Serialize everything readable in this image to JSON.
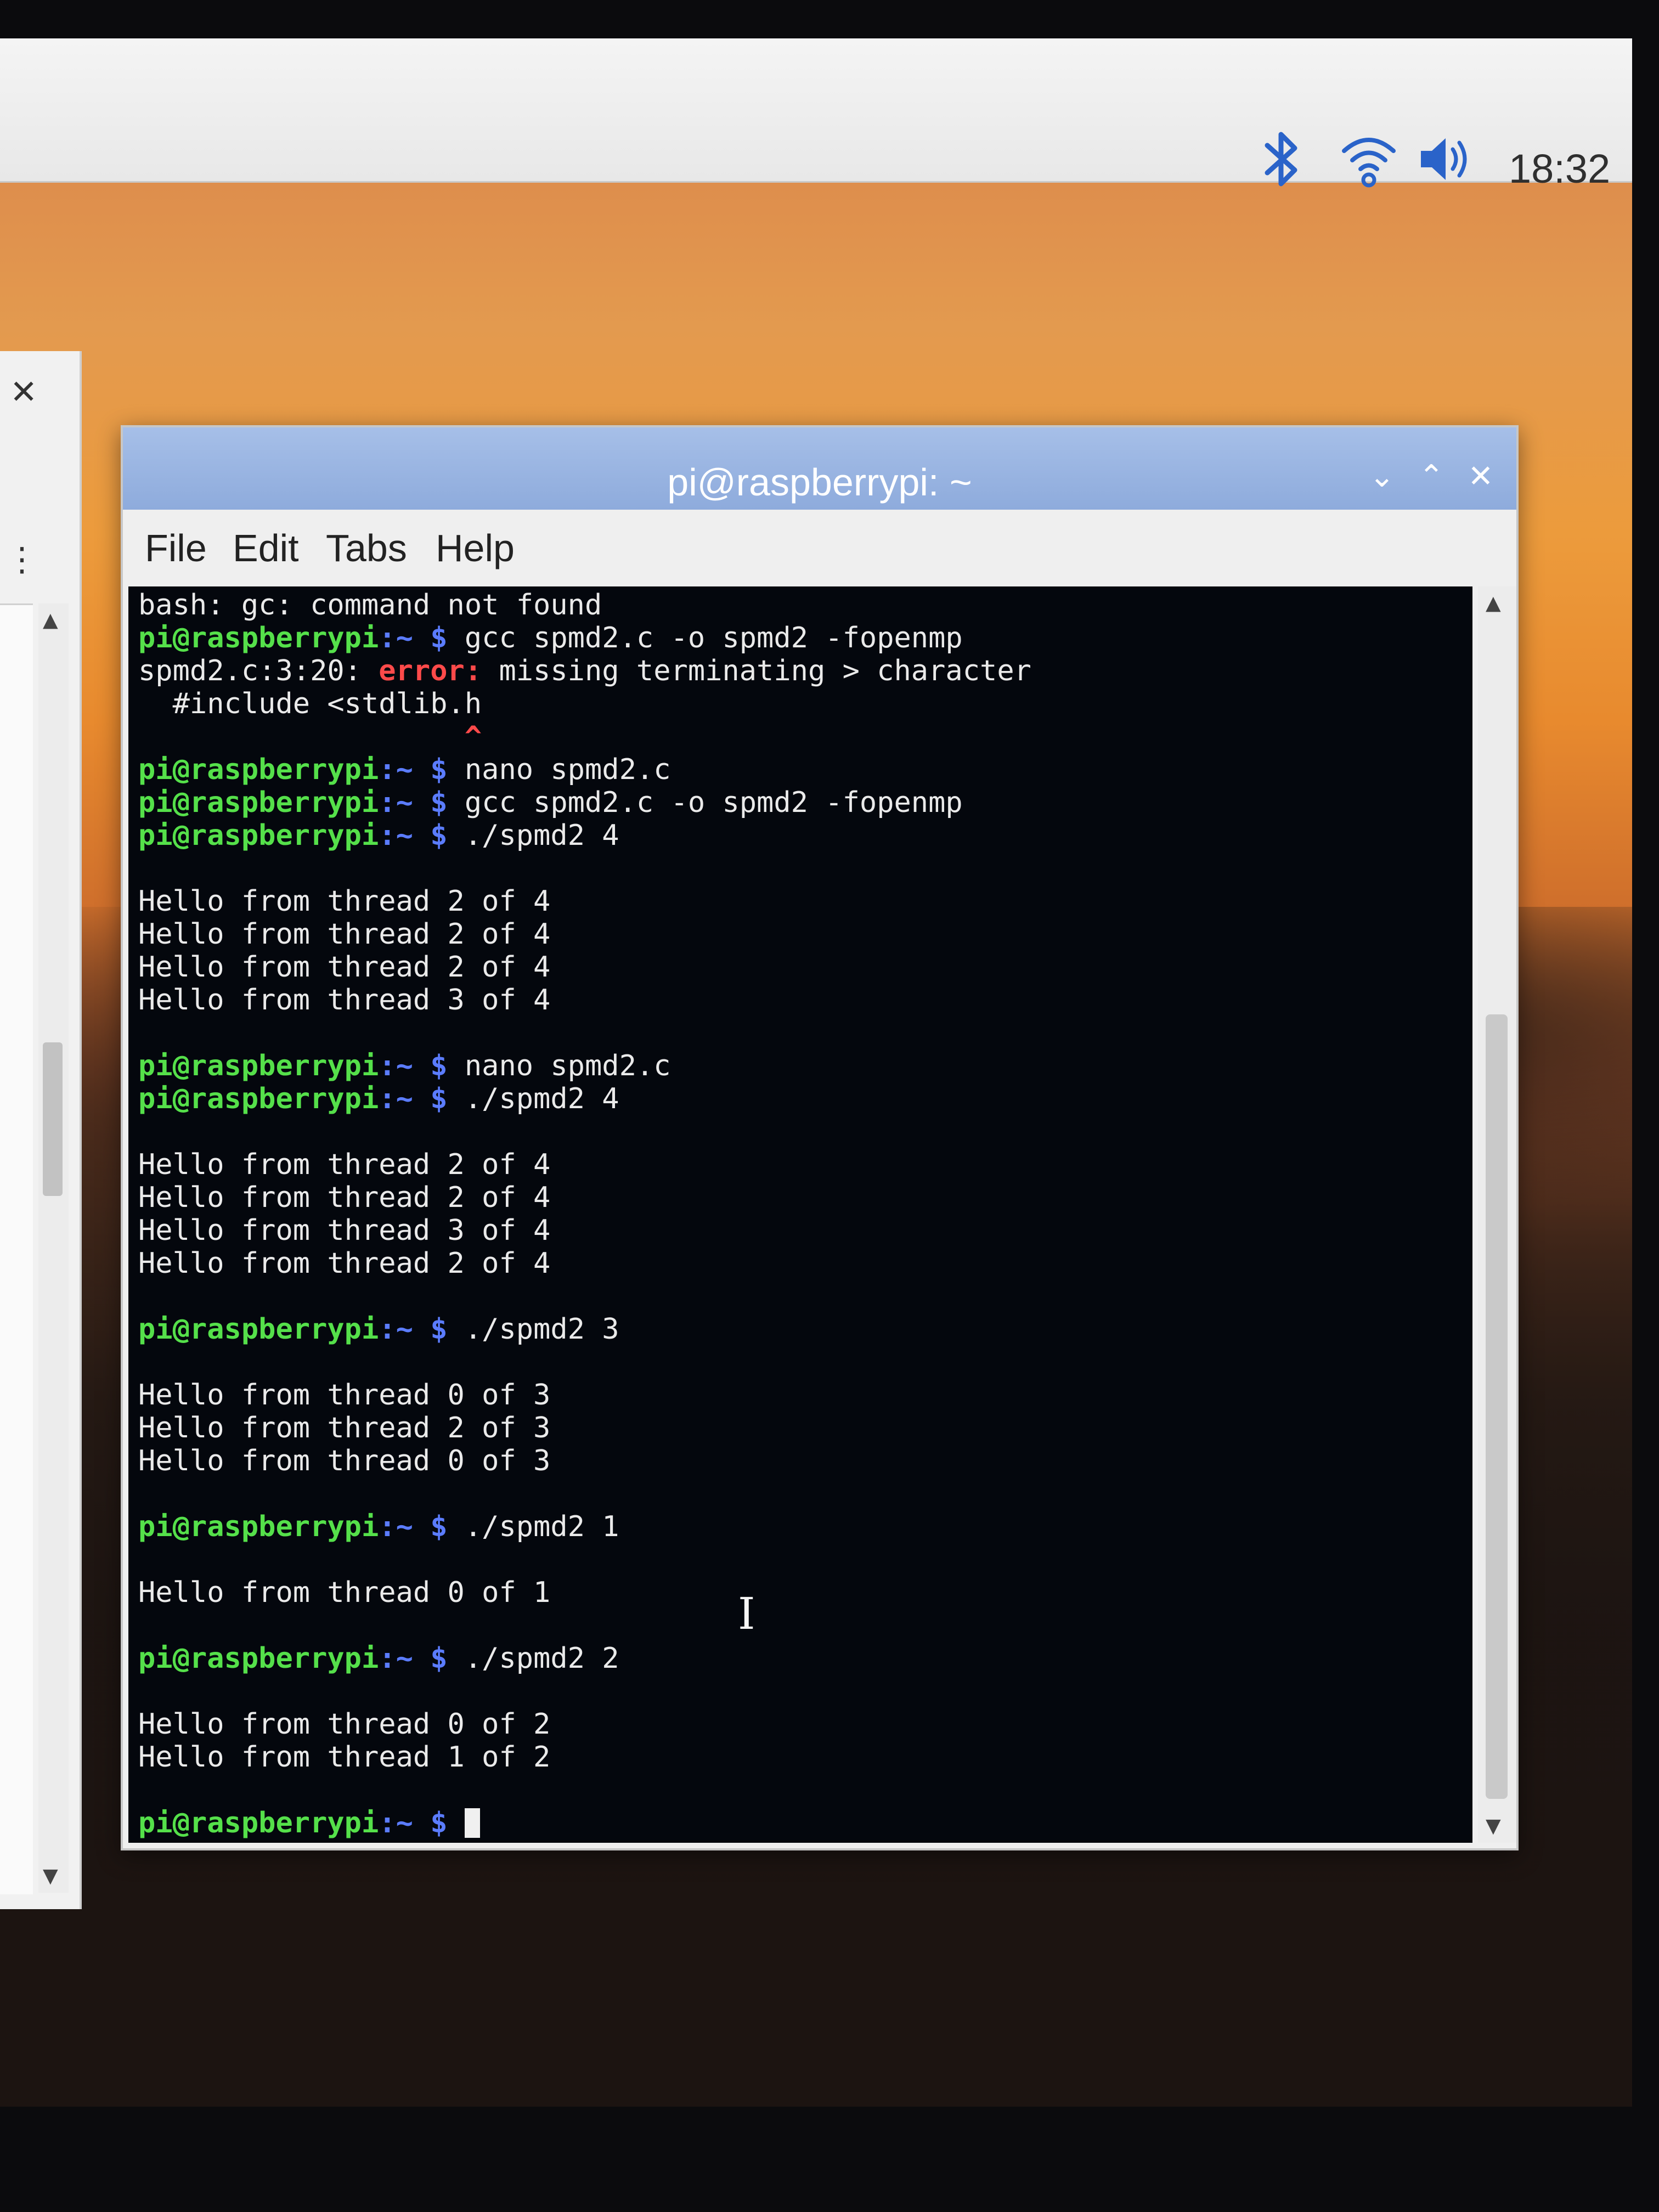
{
  "taskbar": {
    "clock": "18:32",
    "icons": [
      "bluetooth-icon",
      "wifi-icon",
      "volume-icon"
    ]
  },
  "left_window": {
    "close_symbol": "✕",
    "menu_symbol": "⋮"
  },
  "terminal_window": {
    "title": "pi@raspberrypi: ~",
    "controls": {
      "minimize": "⌄",
      "maximize": "⌃",
      "close": "✕"
    },
    "menu": [
      "File",
      "Edit",
      "Tabs",
      "Help"
    ],
    "prompt_user": "pi@raspberrypi",
    "prompt_path": ":~ $",
    "lines": [
      {
        "type": "out",
        "text": "bash: gc: command not found"
      },
      {
        "type": "cmd",
        "text": " gcc spmd2.c -o spmd2 -fopenmp"
      },
      {
        "type": "err",
        "prefix": "spmd2.c:3:20: ",
        "label": "error:",
        "text": " missing terminating > character"
      },
      {
        "type": "out",
        "text": "  #include <stdlib.h"
      },
      {
        "type": "caret",
        "text": "                   ^"
      },
      {
        "type": "cmd",
        "text": " nano spmd2.c"
      },
      {
        "type": "cmd",
        "text": " gcc spmd2.c -o spmd2 -fopenmp"
      },
      {
        "type": "cmd",
        "text": " ./spmd2 4"
      },
      {
        "type": "blank",
        "text": ""
      },
      {
        "type": "out",
        "text": "Hello from thread 2 of 4"
      },
      {
        "type": "out",
        "text": "Hello from thread 2 of 4"
      },
      {
        "type": "out",
        "text": "Hello from thread 2 of 4"
      },
      {
        "type": "out",
        "text": "Hello from thread 3 of 4"
      },
      {
        "type": "blank",
        "text": ""
      },
      {
        "type": "cmd",
        "text": " nano spmd2.c"
      },
      {
        "type": "cmd",
        "text": " ./spmd2 4"
      },
      {
        "type": "blank",
        "text": ""
      },
      {
        "type": "out",
        "text": "Hello from thread 2 of 4"
      },
      {
        "type": "out",
        "text": "Hello from thread 2 of 4"
      },
      {
        "type": "out",
        "text": "Hello from thread 3 of 4"
      },
      {
        "type": "out",
        "text": "Hello from thread 2 of 4"
      },
      {
        "type": "blank",
        "text": ""
      },
      {
        "type": "cmd",
        "text": " ./spmd2 3"
      },
      {
        "type": "blank",
        "text": ""
      },
      {
        "type": "out",
        "text": "Hello from thread 0 of 3"
      },
      {
        "type": "out",
        "text": "Hello from thread 2 of 3"
      },
      {
        "type": "out",
        "text": "Hello from thread 0 of 3"
      },
      {
        "type": "blank",
        "text": ""
      },
      {
        "type": "cmd",
        "text": " ./spmd2 1"
      },
      {
        "type": "blank",
        "text": ""
      },
      {
        "type": "out",
        "text": "Hello from thread 0 of 1"
      },
      {
        "type": "blank",
        "text": ""
      },
      {
        "type": "cmd",
        "text": " ./spmd2 2"
      },
      {
        "type": "blank",
        "text": ""
      },
      {
        "type": "out",
        "text": "Hello from thread 0 of 2"
      },
      {
        "type": "out",
        "text": "Hello from thread 1 of 2"
      },
      {
        "type": "blank",
        "text": ""
      },
      {
        "type": "cmd",
        "text": " ",
        "cursor": true
      }
    ]
  },
  "colors": {
    "prompt_user": "#55e04a",
    "prompt_path": "#5b7cff",
    "error": "#ff4a4a",
    "titlebar": "#9bb6e3"
  }
}
